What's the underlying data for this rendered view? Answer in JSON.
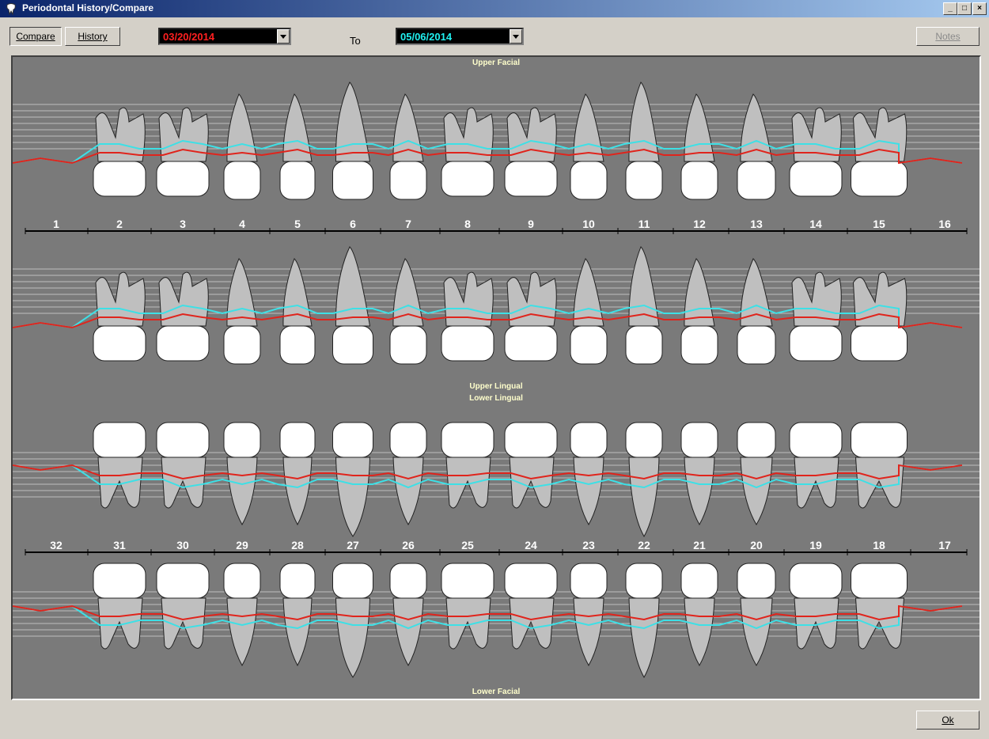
{
  "window": {
    "title": "Periodontal History/Compare",
    "controls": [
      "_",
      "□",
      "×"
    ]
  },
  "toolbar": {
    "compare_label": "Compare",
    "history_label": "History",
    "from_date": "03/20/2014",
    "to_label": "To",
    "to_date": "05/06/2014",
    "notes_label": "Notes"
  },
  "colors": {
    "from_line": "#e0241c",
    "to_line": "#3de0e6",
    "from_text": "#ff2020",
    "to_text": "#20f0f0",
    "chart_bg": "#7a7a7a"
  },
  "labels": {
    "upper_facial": "Upper Facial",
    "upper_lingual": "Upper Lingual",
    "lower_lingual": "Lower Lingual",
    "lower_facial": "Lower Facial"
  },
  "upper_teeth": [
    "1",
    "2",
    "3",
    "4",
    "5",
    "6",
    "7",
    "8",
    "9",
    "10",
    "11",
    "12",
    "13",
    "14",
    "15",
    "16"
  ],
  "lower_teeth": [
    "32",
    "31",
    "30",
    "29",
    "28",
    "27",
    "26",
    "25",
    "24",
    "23",
    "22",
    "21",
    "20",
    "19",
    "18",
    "17"
  ],
  "footer": {
    "ok_label": "Ok"
  }
}
